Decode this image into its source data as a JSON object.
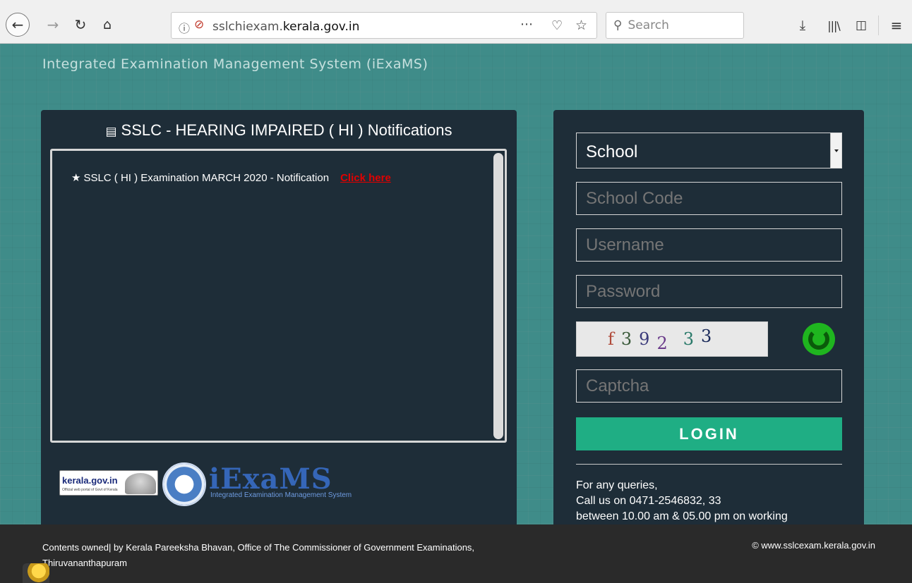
{
  "browser": {
    "url_domain_prefix": "sslchiexam.",
    "url_domain_main": "kerala.gov.in",
    "search_placeholder": "Search",
    "icons": [
      "back-icon",
      "forward-icon",
      "reload-icon",
      "home-icon",
      "info-icon",
      "insecure-lock-icon",
      "page-actions-icon",
      "pocket-icon",
      "bookmark-star-icon",
      "search-icon",
      "download-icon",
      "library-icon",
      "sidebar-icon",
      "menu-icon"
    ]
  },
  "header": {
    "app_title": "Integrated Examination Management System (iExaMS)"
  },
  "notifications": {
    "title": "SSLC - HEARING IMPAIRED ( HI ) Notifications",
    "items": [
      {
        "text": "SSLC ( HI ) Examination MARCH 2020 -  Notification",
        "link_label": "Click here"
      }
    ]
  },
  "logos": {
    "kerala_main": "kerala.gov.in",
    "kerala_sub": "Official web portal of Govt of Kerala",
    "iexams_word": "iExaMS",
    "iexams_tagline": "Integrated Examination Management System"
  },
  "login": {
    "role_selected": "School",
    "school_code_placeholder": "School Code",
    "username_placeholder": "Username",
    "password_placeholder": "Password",
    "captcha_chars": [
      "f",
      "3",
      "9",
      "2",
      "3",
      "3"
    ],
    "captcha_placeholder": "Captcha",
    "login_label": "LOGIN",
    "queries_line1": "For any queries,",
    "queries_line2": "Call us on 0471-2546832, 33",
    "queries_line3": "between 10.00 am & 05.00 pm on working"
  },
  "footer": {
    "left_line1": "Contents owned| by Kerala Pareeksha Bhavan, Office of The Commissioner of Government Examinations,",
    "left_line2": "Thiruvananthapuram",
    "right": "© www.sslcexam.kerala.gov.in"
  },
  "colors": {
    "page_background": "#3f8c89",
    "panel_background": "#1e2d38",
    "login_button": "#1fae84",
    "link_red": "#e00000",
    "refresh_green": "#1fb51f"
  }
}
